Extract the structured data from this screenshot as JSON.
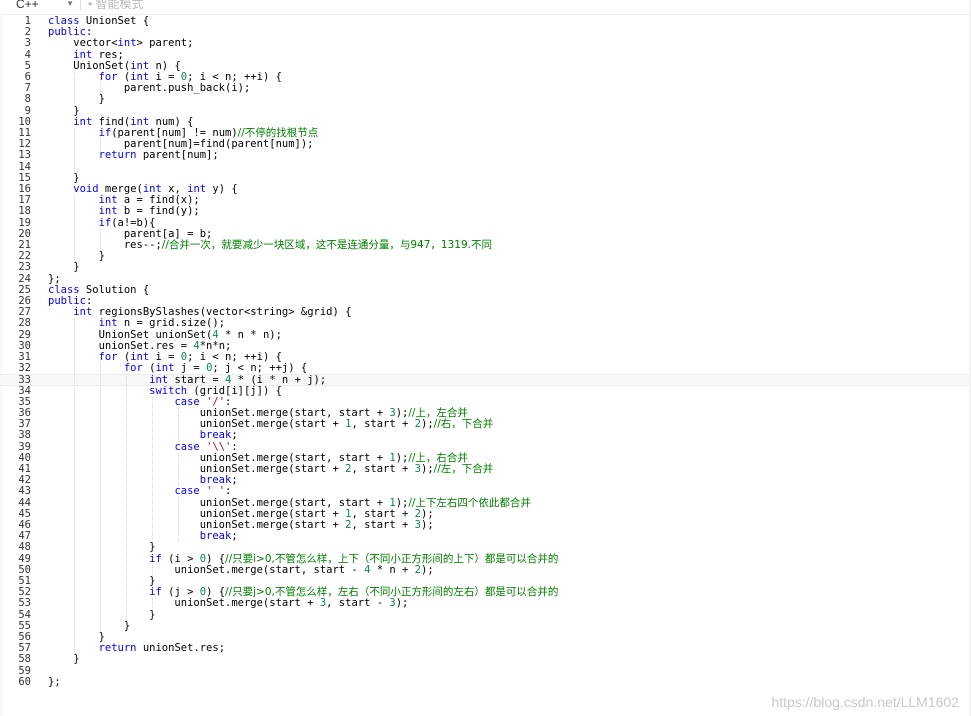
{
  "toolbar": {
    "language": "C++",
    "smart_mode": "• 智能模式"
  },
  "watermark": "https://blog.csdn.net/LLM1602",
  "colors": {
    "keyword": "#0000ff",
    "number": "#098658",
    "string": "#a31515",
    "comment": "#008000",
    "text": "#000000"
  },
  "active_line": 33,
  "lines": [
    [
      [
        "kw",
        "class"
      ],
      [
        "t",
        " UnionSet {"
      ]
    ],
    [
      [
        "kw",
        "public"
      ],
      [
        "t",
        ":"
      ]
    ],
    [
      [
        "t",
        "    vector<"
      ],
      [
        "kw",
        "int"
      ],
      [
        "t",
        "> parent;"
      ]
    ],
    [
      [
        "t",
        "    "
      ],
      [
        "kw",
        "int"
      ],
      [
        "t",
        " res;"
      ]
    ],
    [
      [
        "t",
        "    UnionSet("
      ],
      [
        "kw",
        "int"
      ],
      [
        "t",
        " n) {"
      ]
    ],
    [
      [
        "t",
        "        "
      ],
      [
        "kw",
        "for"
      ],
      [
        "t",
        " ("
      ],
      [
        "kw",
        "int"
      ],
      [
        "t",
        " i = "
      ],
      [
        "num",
        "0"
      ],
      [
        "t",
        "; i < n; ++i) {"
      ]
    ],
    [
      [
        "t",
        "            parent.push_back(i);"
      ]
    ],
    [
      [
        "t",
        "        }"
      ]
    ],
    [
      [
        "t",
        "    }"
      ]
    ],
    [
      [
        "t",
        "    "
      ],
      [
        "kw",
        "int"
      ],
      [
        "t",
        " find("
      ],
      [
        "kw",
        "int"
      ],
      [
        "t",
        " num) {"
      ]
    ],
    [
      [
        "t",
        "        "
      ],
      [
        "kw",
        "if"
      ],
      [
        "t",
        "(parent[num] != num)"
      ],
      [
        "cm",
        "//不停的找根节点"
      ]
    ],
    [
      [
        "t",
        "            parent[num]=find(parent[num]);"
      ]
    ],
    [
      [
        "t",
        "        "
      ],
      [
        "kw",
        "return"
      ],
      [
        "t",
        " parent[num];"
      ]
    ],
    [
      [
        "t",
        ""
      ]
    ],
    [
      [
        "t",
        "    }"
      ]
    ],
    [
      [
        "t",
        "    "
      ],
      [
        "kw",
        "void"
      ],
      [
        "t",
        " merge("
      ],
      [
        "kw",
        "int"
      ],
      [
        "t",
        " x, "
      ],
      [
        "kw",
        "int"
      ],
      [
        "t",
        " y) {"
      ]
    ],
    [
      [
        "t",
        "        "
      ],
      [
        "kw",
        "int"
      ],
      [
        "t",
        " a = find(x);"
      ]
    ],
    [
      [
        "t",
        "        "
      ],
      [
        "kw",
        "int"
      ],
      [
        "t",
        " b = find(y);"
      ]
    ],
    [
      [
        "t",
        "        "
      ],
      [
        "kw",
        "if"
      ],
      [
        "t",
        "(a!=b){"
      ]
    ],
    [
      [
        "t",
        "            parent[a] = b;"
      ]
    ],
    [
      [
        "t",
        "            res--;"
      ],
      [
        "cm",
        "//合并一次，就要减少一块区域，这不是连通分量，与947，1319.不同"
      ]
    ],
    [
      [
        "t",
        "        }"
      ]
    ],
    [
      [
        "t",
        "    }"
      ]
    ],
    [
      [
        "t",
        "};"
      ]
    ],
    [
      [
        "kw",
        "class"
      ],
      [
        "t",
        " Solution {"
      ]
    ],
    [
      [
        "kw",
        "public"
      ],
      [
        "t",
        ":"
      ]
    ],
    [
      [
        "t",
        "    "
      ],
      [
        "kw",
        "int"
      ],
      [
        "t",
        " regionsBySlashes(vector<string> &grid) {"
      ]
    ],
    [
      [
        "t",
        "        "
      ],
      [
        "kw",
        "int"
      ],
      [
        "t",
        " n = grid.size();"
      ]
    ],
    [
      [
        "t",
        "        UnionSet unionSet("
      ],
      [
        "num",
        "4"
      ],
      [
        "t",
        " * n * n);"
      ]
    ],
    [
      [
        "t",
        "        unionSet.res = "
      ],
      [
        "num",
        "4"
      ],
      [
        "t",
        "*n*n;"
      ]
    ],
    [
      [
        "t",
        "        "
      ],
      [
        "kw",
        "for"
      ],
      [
        "t",
        " ("
      ],
      [
        "kw",
        "int"
      ],
      [
        "t",
        " i = "
      ],
      [
        "num",
        "0"
      ],
      [
        "t",
        "; i < n; ++i) {"
      ]
    ],
    [
      [
        "t",
        "            "
      ],
      [
        "kw",
        "for"
      ],
      [
        "t",
        " ("
      ],
      [
        "kw",
        "int"
      ],
      [
        "t",
        " j = "
      ],
      [
        "num",
        "0"
      ],
      [
        "t",
        "; j < n; ++j) {"
      ]
    ],
    [
      [
        "t",
        "                "
      ],
      [
        "kw",
        "int"
      ],
      [
        "t",
        " start = "
      ],
      [
        "num",
        "4"
      ],
      [
        "t",
        " * (i * n + j);"
      ]
    ],
    [
      [
        "t",
        "                "
      ],
      [
        "kw",
        "switch"
      ],
      [
        "t",
        " (grid[i][j]) {"
      ]
    ],
    [
      [
        "t",
        "                    "
      ],
      [
        "kw",
        "case"
      ],
      [
        "t",
        " "
      ],
      [
        "str",
        "'/'"
      ],
      [
        "t",
        ":"
      ]
    ],
    [
      [
        "t",
        "                        unionSet.merge(start, start + "
      ],
      [
        "num",
        "3"
      ],
      [
        "t",
        ");"
      ],
      [
        "cm",
        "//上，左合并"
      ]
    ],
    [
      [
        "t",
        "                        unionSet.merge(start + "
      ],
      [
        "num",
        "1"
      ],
      [
        "t",
        ", start + "
      ],
      [
        "num",
        "2"
      ],
      [
        "t",
        ");"
      ],
      [
        "cm",
        "//右，下合并"
      ]
    ],
    [
      [
        "t",
        "                        "
      ],
      [
        "kw",
        "break"
      ],
      [
        "t",
        ";"
      ]
    ],
    [
      [
        "t",
        "                    "
      ],
      [
        "kw",
        "case"
      ],
      [
        "t",
        " "
      ],
      [
        "str",
        "'\\\\'"
      ],
      [
        "t",
        ":"
      ]
    ],
    [
      [
        "t",
        "                        unionSet.merge(start, start + "
      ],
      [
        "num",
        "1"
      ],
      [
        "t",
        ");"
      ],
      [
        "cm",
        "//上，右合并"
      ]
    ],
    [
      [
        "t",
        "                        unionSet.merge(start + "
      ],
      [
        "num",
        "2"
      ],
      [
        "t",
        ", start + "
      ],
      [
        "num",
        "3"
      ],
      [
        "t",
        ");"
      ],
      [
        "cm",
        "//左，下合并"
      ]
    ],
    [
      [
        "t",
        "                        "
      ],
      [
        "kw",
        "break"
      ],
      [
        "t",
        ";"
      ]
    ],
    [
      [
        "t",
        "                    "
      ],
      [
        "kw",
        "case"
      ],
      [
        "t",
        " "
      ],
      [
        "str",
        "' '"
      ],
      [
        "t",
        ":"
      ]
    ],
    [
      [
        "t",
        "                        unionSet.merge(start, start + "
      ],
      [
        "num",
        "1"
      ],
      [
        "t",
        ");"
      ],
      [
        "cm",
        "//上下左右四个依此都合并"
      ]
    ],
    [
      [
        "t",
        "                        unionSet.merge(start + "
      ],
      [
        "num",
        "1"
      ],
      [
        "t",
        ", start + "
      ],
      [
        "num",
        "2"
      ],
      [
        "t",
        ");"
      ]
    ],
    [
      [
        "t",
        "                        unionSet.merge(start + "
      ],
      [
        "num",
        "2"
      ],
      [
        "t",
        ", start + "
      ],
      [
        "num",
        "3"
      ],
      [
        "t",
        ");"
      ]
    ],
    [
      [
        "t",
        "                        "
      ],
      [
        "kw",
        "break"
      ],
      [
        "t",
        ";"
      ]
    ],
    [
      [
        "t",
        "                }"
      ]
    ],
    [
      [
        "t",
        "                "
      ],
      [
        "kw",
        "if"
      ],
      [
        "t",
        " (i > "
      ],
      [
        "num",
        "0"
      ],
      [
        "t",
        ") {"
      ],
      [
        "cm",
        "//只要i>0,不管怎么样，上下（不同小正方形间的上下）都是可以合并的"
      ]
    ],
    [
      [
        "t",
        "                    unionSet.merge(start, start - "
      ],
      [
        "num",
        "4"
      ],
      [
        "t",
        " * n + "
      ],
      [
        "num",
        "2"
      ],
      [
        "t",
        ");"
      ]
    ],
    [
      [
        "t",
        "                }"
      ]
    ],
    [
      [
        "t",
        "                "
      ],
      [
        "kw",
        "if"
      ],
      [
        "t",
        " (j > "
      ],
      [
        "num",
        "0"
      ],
      [
        "t",
        ") {"
      ],
      [
        "cm",
        "//只要j>0,不管怎么样，左右（不同小正方形间的左右）都是可以合并的"
      ]
    ],
    [
      [
        "t",
        "                    unionSet.merge(start + "
      ],
      [
        "num",
        "3"
      ],
      [
        "t",
        ", start - "
      ],
      [
        "num",
        "3"
      ],
      [
        "t",
        ");"
      ]
    ],
    [
      [
        "t",
        "                }"
      ]
    ],
    [
      [
        "t",
        "            }"
      ]
    ],
    [
      [
        "t",
        "        }"
      ]
    ],
    [
      [
        "t",
        "        "
      ],
      [
        "kw",
        "return"
      ],
      [
        "t",
        " unionSet.res;"
      ]
    ],
    [
      [
        "t",
        "    }"
      ]
    ],
    [
      [
        "t",
        ""
      ]
    ],
    [
      [
        "t",
        "};"
      ]
    ]
  ]
}
